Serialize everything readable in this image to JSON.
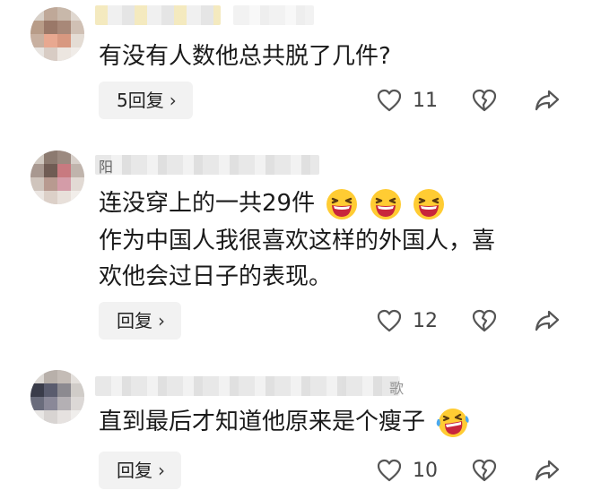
{
  "comments": [
    {
      "text_lines": [
        "有没有人数他总共脱了几件?"
      ],
      "reply_label": "5回复",
      "likes": "11"
    },
    {
      "name_partial": "阳",
      "text_lines": [
        "连没穿上的一共29件",
        "作为中国人我很喜欢这样的外国人，喜",
        "欢他会过日子的表现。"
      ],
      "emoji": [
        "laughing-emoji",
        "laughing-emoji",
        "laughing-emoji"
      ],
      "reply_label": "回复",
      "likes": "12"
    },
    {
      "name_partial": "歌",
      "text_lines": [
        "直到最后才知道他原来是个瘦子"
      ],
      "emoji": [
        "crying-laughing-emoji"
      ],
      "reply_label": "回复",
      "likes": "10"
    }
  ],
  "colors": {
    "text": "#1a1a1a",
    "reply_bg": "#f2f2f2",
    "icon": "#555555",
    "emoji_face": "#ffcc33"
  }
}
